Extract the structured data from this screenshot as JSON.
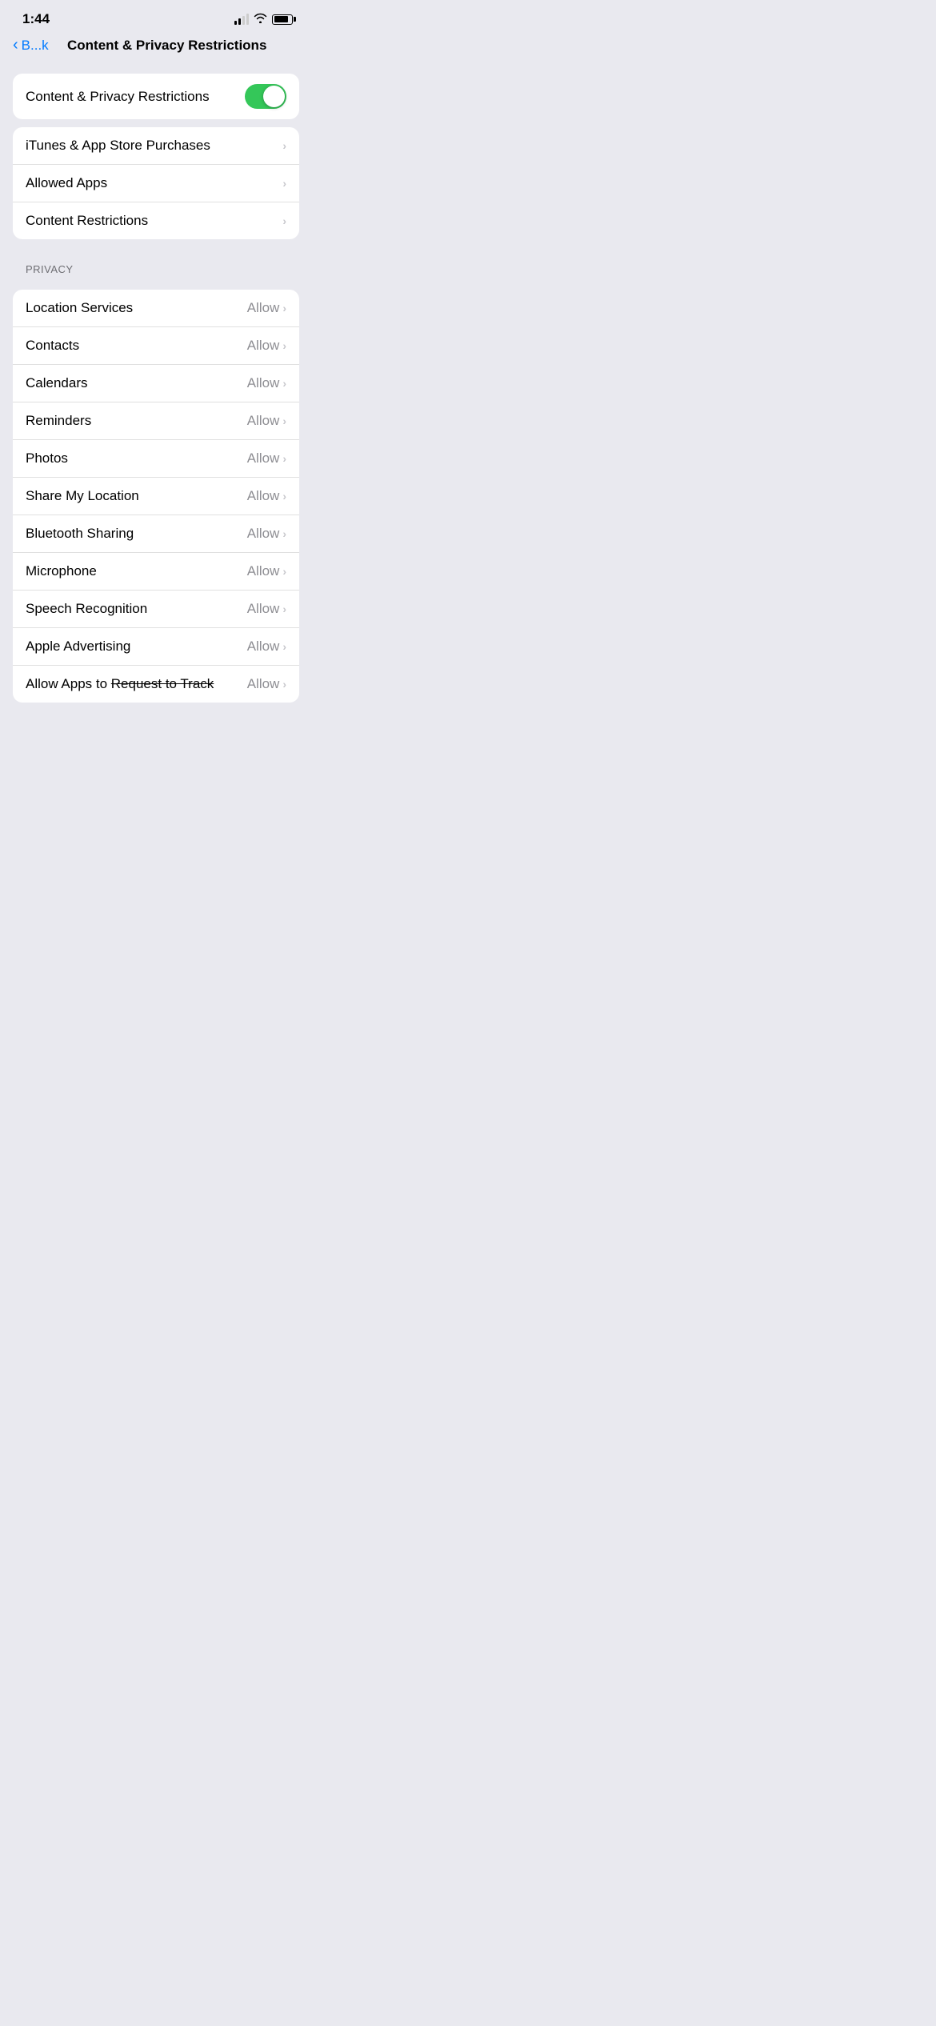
{
  "statusBar": {
    "time": "1:44",
    "batteryLevel": 85
  },
  "nav": {
    "backLabel": "B...k",
    "title": "Content & Privacy Restrictions"
  },
  "toggle": {
    "label": "Content & Privacy Restrictions",
    "enabled": true
  },
  "mainItems": [
    {
      "label": "iTunes & App Store Purchases",
      "value": ""
    },
    {
      "label": "Allowed Apps",
      "value": ""
    },
    {
      "label": "Content Restrictions",
      "value": ""
    }
  ],
  "privacySectionLabel": "PRIVACY",
  "privacyItems": [
    {
      "label": "Location Services",
      "value": "Allow"
    },
    {
      "label": "Contacts",
      "value": "Allow"
    },
    {
      "label": "Calendars",
      "value": "Allow"
    },
    {
      "label": "Reminders",
      "value": "Allow"
    },
    {
      "label": "Photos",
      "value": "Allow"
    },
    {
      "label": "Share My Location",
      "value": "Allow"
    },
    {
      "label": "Bluetooth Sharing",
      "value": "Allow"
    },
    {
      "label": "Microphone",
      "value": "Allow"
    },
    {
      "label": "Speech Recognition",
      "value": "Allow"
    },
    {
      "label": "Apple Advertising",
      "value": "Allow"
    },
    {
      "label": "Allow Apps to Request to Track",
      "value": "Allow",
      "strikethrough": true
    }
  ]
}
